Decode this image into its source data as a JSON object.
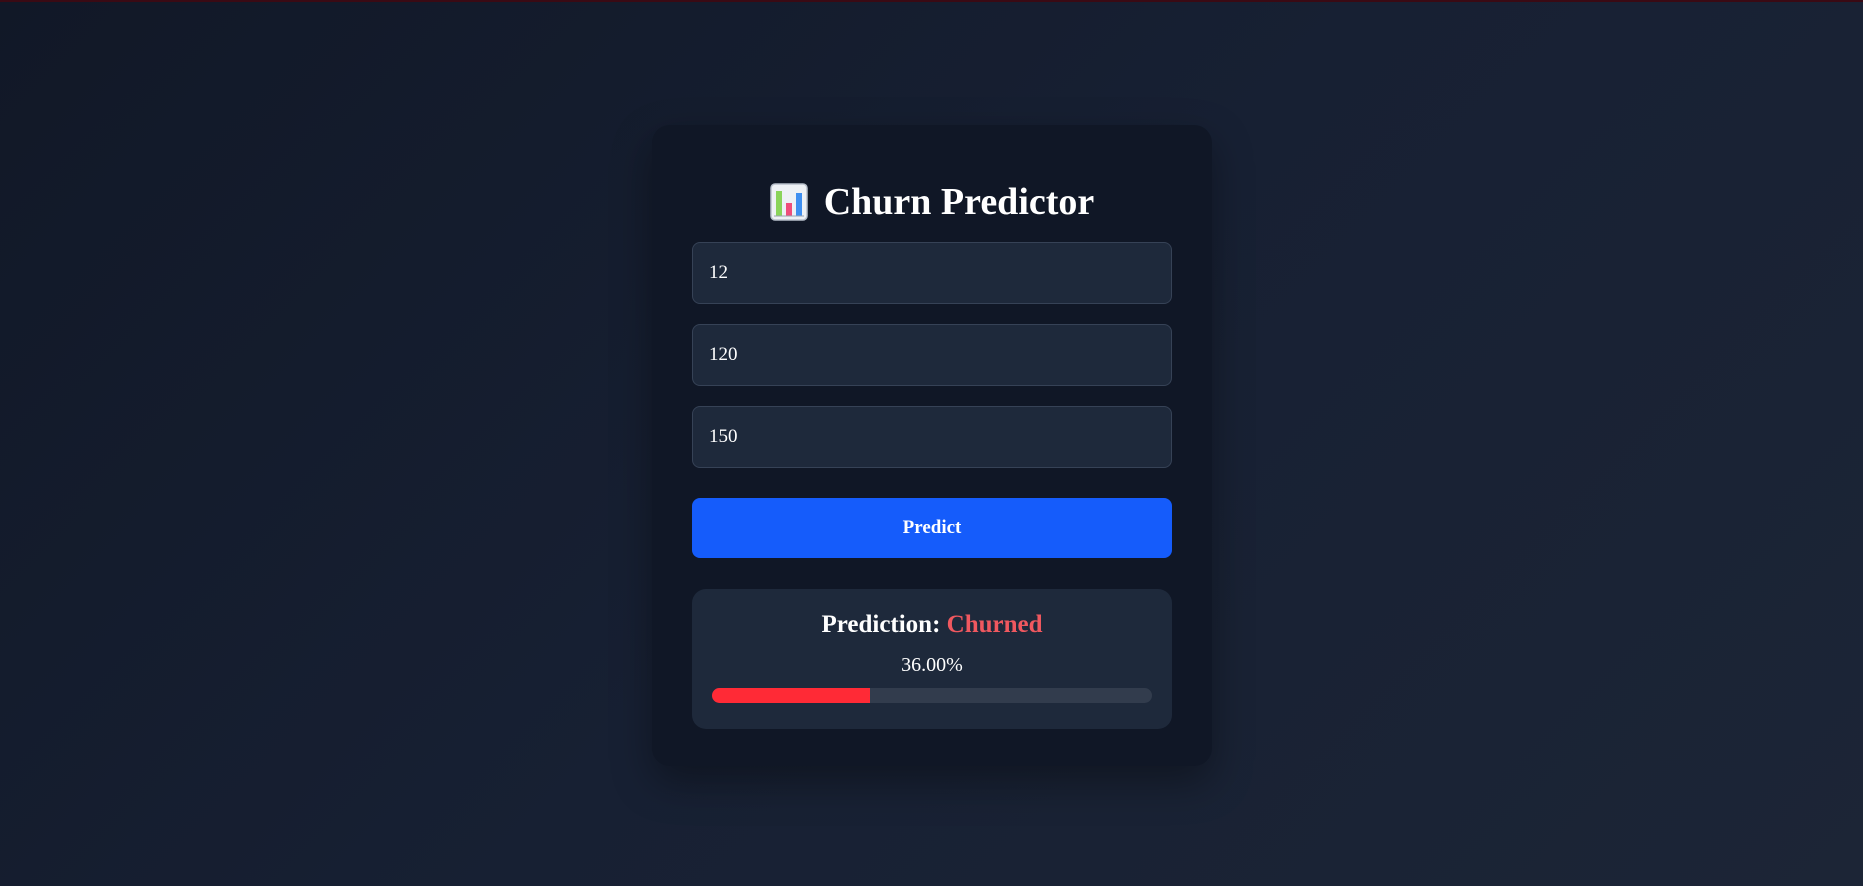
{
  "app": {
    "title_icon": "bar-chart-icon",
    "title": "Churn Predictor"
  },
  "form": {
    "field_1_value": "12",
    "field_2_value": "120",
    "field_3_value": "150",
    "predict_label": "Predict"
  },
  "result": {
    "label": "Prediction:",
    "value": "Churned",
    "probability_text": "36.00%",
    "probability_fraction": 0.36
  },
  "colors": {
    "accent": "#155cfb",
    "churned": "#f0585f",
    "progress_fill": "#ff2a36",
    "card_bg": "#101726",
    "field_bg": "#1e293b"
  }
}
